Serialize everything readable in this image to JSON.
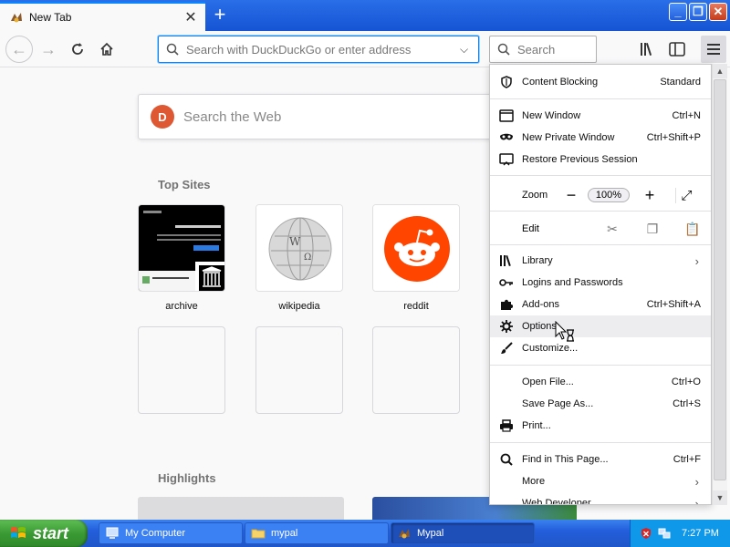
{
  "browser": {
    "tab_title": "New Tab",
    "url_placeholder": "Search with DuckDuckGo or enter address",
    "search_placeholder": "Search"
  },
  "newtab": {
    "search_placeholder": "Search the Web",
    "top_sites_heading": "Top Sites",
    "highlights_heading": "Highlights",
    "tiles": [
      {
        "label": "archive"
      },
      {
        "label": "wikipedia"
      },
      {
        "label": "reddit"
      }
    ]
  },
  "menu": {
    "content_blocking": {
      "label": "Content Blocking",
      "value": "Standard"
    },
    "new_window": {
      "label": "New Window",
      "shortcut": "Ctrl+N"
    },
    "new_private": {
      "label": "New Private Window",
      "shortcut": "Ctrl+Shift+P"
    },
    "restore": {
      "label": "Restore Previous Session"
    },
    "zoom": {
      "label": "Zoom",
      "value": "100%"
    },
    "edit": {
      "label": "Edit"
    },
    "library": {
      "label": "Library"
    },
    "logins": {
      "label": "Logins and Passwords"
    },
    "addons": {
      "label": "Add-ons",
      "shortcut": "Ctrl+Shift+A"
    },
    "options": {
      "label": "Options"
    },
    "customize": {
      "label": "Customize..."
    },
    "open_file": {
      "label": "Open File...",
      "shortcut": "Ctrl+O"
    },
    "save_page": {
      "label": "Save Page As...",
      "shortcut": "Ctrl+S"
    },
    "print": {
      "label": "Print..."
    },
    "find": {
      "label": "Find in This Page...",
      "shortcut": "Ctrl+F"
    },
    "more": {
      "label": "More"
    },
    "web_dev": {
      "label": "Web Developer"
    }
  },
  "taskbar": {
    "start_label": "start",
    "tasks": [
      {
        "label": "My Computer"
      },
      {
        "label": "mypal"
      },
      {
        "label": "Mypal"
      }
    ],
    "clock": "7:27 PM"
  },
  "colors": {
    "accent": "#0a84ff",
    "xp_blue": "#245edb",
    "start_green": "#3b9a34",
    "reddit_orange": "#ff4500",
    "ddg_orange": "#de5833"
  }
}
